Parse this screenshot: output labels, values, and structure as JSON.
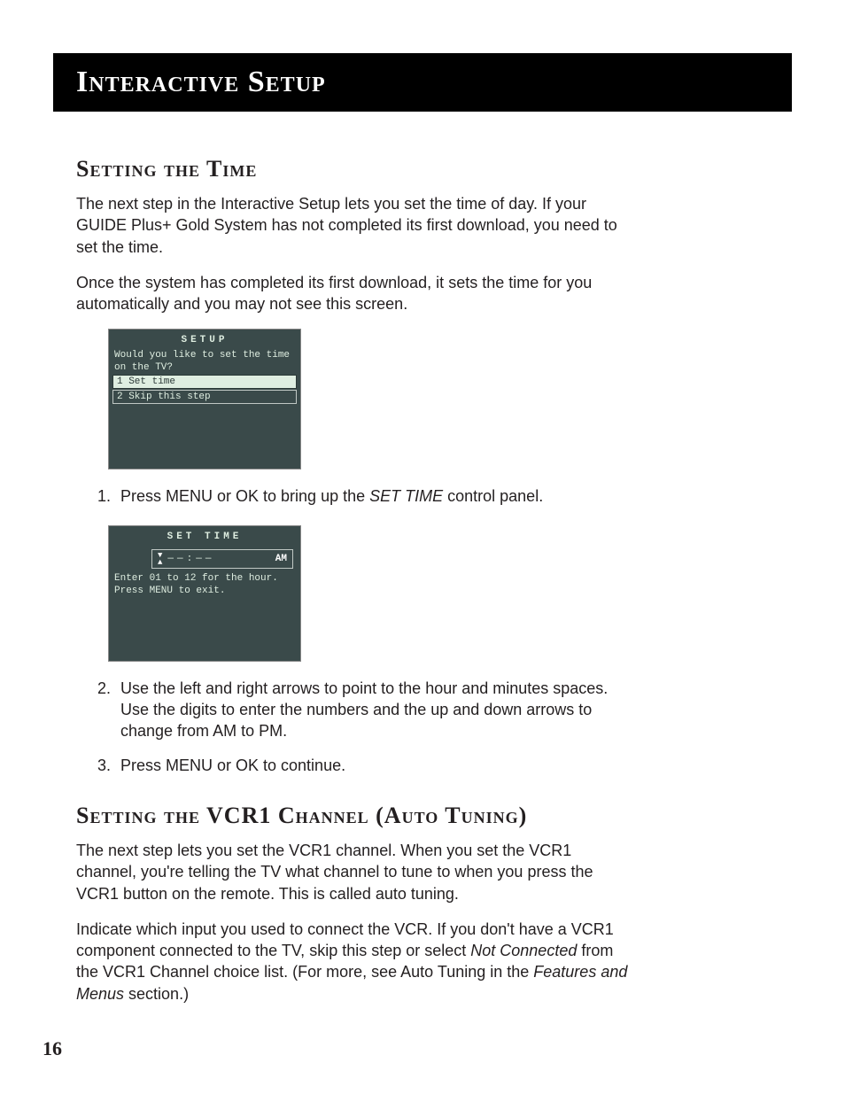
{
  "banner": {
    "title": "Interactive Setup"
  },
  "section1": {
    "title": "Setting the Time",
    "p1": "The next step in the Interactive Setup lets you set the time of day. If your GUIDE Plus+ Gold System has not completed its first download, you need to set the time.",
    "p2": "Once the system has completed its first download, it sets the time for you automatically and you may not see this screen."
  },
  "screen1": {
    "title": "SETUP",
    "prompt1": "Would you like to set the time",
    "prompt2": "on the TV?",
    "option1": "1 Set time",
    "option2": "2 Skip this step"
  },
  "steps_a": {
    "s1_a": "Press MENU or OK to bring up the ",
    "s1_b": "SET TIME",
    "s1_c": " control panel."
  },
  "screen2": {
    "title": "SET TIME",
    "dash": "—",
    "colon": ":",
    "ampm": "AM",
    "help1": "Enter 01 to 12 for the hour.",
    "help2": "Press MENU to exit."
  },
  "steps_b": {
    "s2": "Use the left and right arrows to point to the hour and minutes spaces. Use the digits to enter the numbers and the up and down arrows to change from AM to PM.",
    "s3": "Press  MENU or OK to continue."
  },
  "section2": {
    "title": "Setting the  VCR1 Channel (Auto Tuning)",
    "p1": "The next step lets you set the VCR1 channel. When you set the VCR1 channel, you're telling the TV what channel to tune to when you press the VCR1 button on the remote. This is called auto tuning.",
    "p2_a": "Indicate which input you used to connect the VCR.  If you don't have a VCR1 component connected to the TV, skip this step or select ",
    "p2_b": "Not Connected",
    "p2_c": " from the VCR1 Channel choice list. (For more, see Auto Tuning in the ",
    "p2_d": "Features and Menus",
    "p2_e": " section.)"
  },
  "page_number": "16"
}
